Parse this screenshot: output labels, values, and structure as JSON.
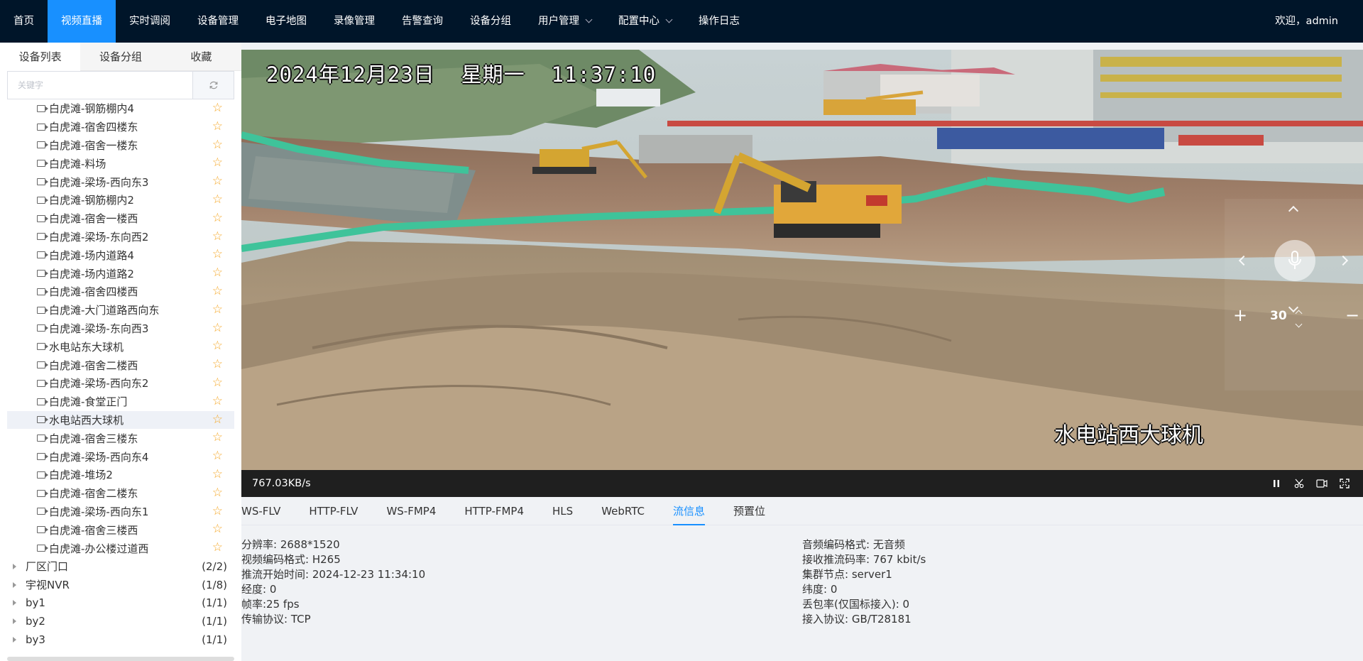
{
  "nav": {
    "items": [
      {
        "label": "首页"
      },
      {
        "label": "视频直播",
        "active": true
      },
      {
        "label": "实时调阅"
      },
      {
        "label": "设备管理"
      },
      {
        "label": "电子地图"
      },
      {
        "label": "录像管理"
      },
      {
        "label": "告警查询"
      },
      {
        "label": "设备分组"
      },
      {
        "label": "用户管理",
        "dropdown": true
      },
      {
        "label": "配置中心",
        "dropdown": true
      },
      {
        "label": "操作日志"
      }
    ],
    "welcome": "欢迎，admin"
  },
  "sidebar": {
    "tabs": [
      "设备列表",
      "设备分组",
      "收藏"
    ],
    "search_placeholder": "关键字",
    "devices": [
      "白虎滩-钢筋棚内4",
      "白虎滩-宿舍四楼东",
      "白虎滩-宿舍一楼东",
      "白虎滩-料场",
      "白虎滩-梁场-西向东3",
      "白虎滩-钢筋棚内2",
      "白虎滩-宿舍一楼西",
      "白虎滩-梁场-东向西2",
      "白虎滩-场内道路4",
      "白虎滩-场内道路2",
      "白虎滩-宿舍四楼西",
      "白虎滩-大门道路西向东",
      "白虎滩-梁场-东向西3",
      "水电站东大球机",
      "白虎滩-宿舍二楼西",
      "白虎滩-梁场-西向东2",
      "白虎滩-食堂正门",
      "水电站西大球机",
      "白虎滩-宿舍三楼东",
      "白虎滩-梁场-西向东4",
      "白虎滩-堆场2",
      "白虎滩-宿舍二楼东",
      "白虎滩-梁场-西向东1",
      "白虎滩-宿舍三楼西",
      "白虎滩-办公楼过道西"
    ],
    "selected_device": "水电站西大球机",
    "groups": [
      {
        "label": "厂区门口",
        "count": "(2/2)"
      },
      {
        "label": "宇视NVR",
        "count": "(1/8)"
      },
      {
        "label": "by1",
        "count": "(1/1)"
      },
      {
        "label": "by2",
        "count": "(1/1)"
      },
      {
        "label": "by3",
        "count": "(1/1)"
      }
    ]
  },
  "video": {
    "osd_time": "2024年12月23日  星期一  11:37:10",
    "osd_name": "水电站西大球机",
    "ptz_speed": "30",
    "bitrate": "767.03KB/s"
  },
  "tabs": [
    "WS-FLV",
    "HTTP-FLV",
    "WS-FMP4",
    "HTTP-FMP4",
    "HLS",
    "WebRTC",
    "流信息",
    "预置位"
  ],
  "active_tab": "流信息",
  "stream_info": {
    "left": [
      "分辨率:  2688*1520",
      "视频编码格式:  H265",
      "推流开始时间:  2024-12-23 11:34:10",
      "经度:  0",
      "帧率:25 fps",
      "传输协议:  TCP"
    ],
    "right": [
      "音频编码格式:  无音频",
      "接收推流码率:  767 kbit/s",
      "集群节点:  server1",
      "纬度:  0",
      "丢包率(仅国标接入):  0",
      "接入协议:  GB/T28181"
    ]
  },
  "colors": {
    "nav_bg": "#001529",
    "accent": "#1890ff",
    "star": "#f5a623"
  }
}
